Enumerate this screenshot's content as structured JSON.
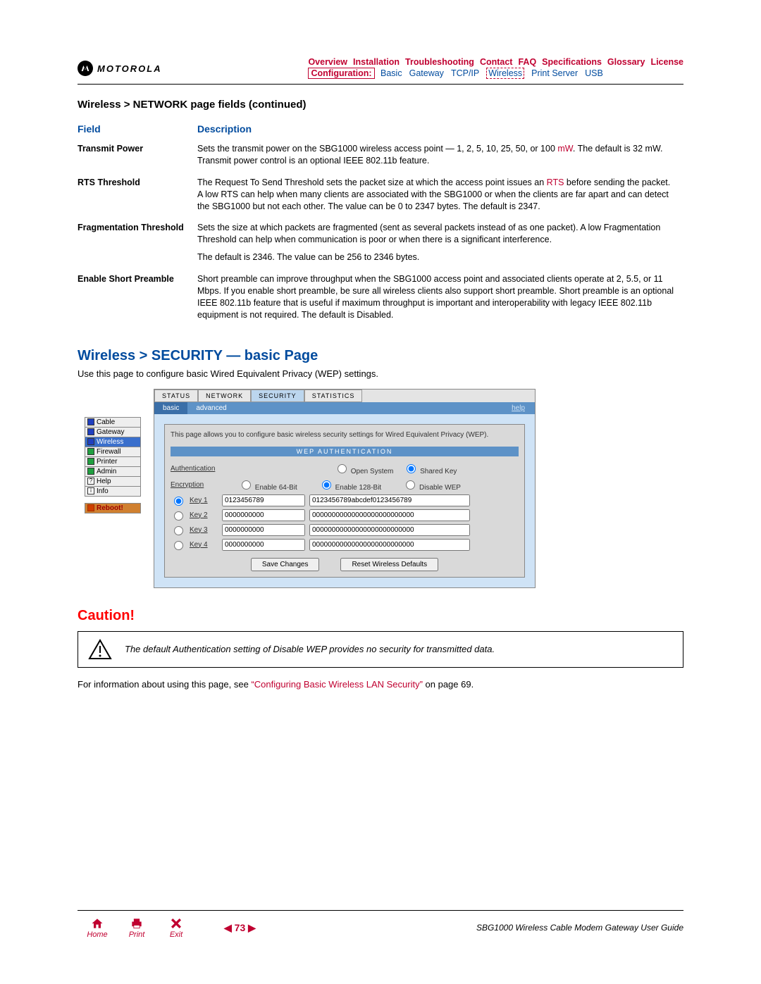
{
  "brand": "MOTOROLA",
  "nav_top": [
    "Overview",
    "Installation",
    "Troubleshooting",
    "Contact",
    "FAQ",
    "Specifications",
    "Glossary",
    "License"
  ],
  "nav_sub": {
    "label": "Configuration:",
    "items": [
      "Basic",
      "Gateway",
      "TCP/IP",
      "Wireless",
      "Print Server",
      "USB"
    ],
    "active": "Wireless"
  },
  "section_title": "Wireless > NETWORK page fields (continued)",
  "th_field": "Field",
  "th_desc": "Description",
  "rows": [
    {
      "name": "Transmit Power",
      "desc_pre": "Sets the transmit power on the SBG1000 wireless access point — 1, 2, 5, 10, 25, 50, or 100 ",
      "gloss": "mW",
      "desc_post": ". The default is 32 mW. Transmit power control is an optional IEEE 802.11b feature."
    },
    {
      "name": "RTS Threshold",
      "desc_pre": "The Request To Send Threshold sets the packet size at which the access point issues an ",
      "gloss": "RTS",
      "desc_post": " before sending the packet. A low RTS can help when many clients are associated with the SBG1000 or when the clients are far apart and can detect the SBG1000 but not each other. The value can be 0 to 2347 bytes. The default is 2347."
    },
    {
      "name": "Fragmentation Threshold",
      "desc_pre": "Sets the size at which packets are fragmented (sent as several packets instead of as one packet). A low Fragmentation Threshold can help when communication is poor or when there is a significant interference.",
      "gloss": "",
      "desc_post": "",
      "desc_para2": "The default is 2346. The value can be 256 to 2346 bytes."
    },
    {
      "name": "Enable Short Preamble",
      "desc_pre": "Short preamble can improve throughput when the SBG1000 access point and associated clients operate at 2, 5.5, or 11 Mbps. If you enable short preamble, be sure all wireless clients also support short preamble. Short preamble is an optional IEEE 802.11b feature that is useful if maximum throughput is important and interoperability with legacy IEEE 802.11b equipment is not required. The default is Disabled.",
      "gloss": "",
      "desc_post": ""
    }
  ],
  "h2_blue": "Wireless > SECURITY — basic Page",
  "intro": "Use this page to configure basic Wired Equivalent Privacy (WEP) settings.",
  "sidenav": [
    {
      "label": "Cable",
      "cls": "blue"
    },
    {
      "label": "Gateway",
      "cls": "blue"
    },
    {
      "label": "Wireless",
      "cls": "blue",
      "active": true
    },
    {
      "label": "Firewall",
      "cls": "grn"
    },
    {
      "label": "Printer",
      "cls": "grn"
    },
    {
      "label": "Admin",
      "cls": "grn"
    },
    {
      "label": "Help",
      "cls": "q",
      "prefix": "?"
    },
    {
      "label": "Info",
      "cls": "q",
      "prefix": "i"
    }
  ],
  "reboot": "Reboot!",
  "tabs1": [
    "STATUS",
    "NETWORK",
    "SECURITY",
    "STATISTICS"
  ],
  "tabs1_active": "SECURITY",
  "tabs2": [
    "basic",
    "advanced"
  ],
  "tabs2_active": "basic",
  "help": "help",
  "panel_note": "This page allows you to configure basic wireless security settings for Wired Equivalent Privacy (WEP).",
  "wep_title": "WEP AUTHENTICATION",
  "auth_label": "Authentication",
  "auth_opts": [
    "Open System",
    "Shared Key"
  ],
  "auth_sel": "Shared Key",
  "enc_label": "Encryption",
  "enc_opts": [
    "Enable 64-Bit",
    "Enable 128-Bit",
    "Disable WEP"
  ],
  "enc_sel": "Enable 128-Bit",
  "keys": [
    {
      "label": "Key 1",
      "sel": true,
      "v64": "0123456789",
      "v128": "0123456789abcdef0123456789"
    },
    {
      "label": "Key 2",
      "sel": false,
      "v64": "0000000000",
      "v128": "00000000000000000000000000"
    },
    {
      "label": "Key 3",
      "sel": false,
      "v64": "0000000000",
      "v128": "00000000000000000000000000"
    },
    {
      "label": "Key 4",
      "sel": false,
      "v64": "0000000000",
      "v128": "00000000000000000000000000"
    }
  ],
  "btn_save": "Save Changes",
  "btn_reset": "Reset Wireless Defaults",
  "h2_red": "Caution!",
  "caution": "The default Authentication setting of Disable WEP provides no security for transmitted data.",
  "after_pre": "For information about using this page, see ",
  "after_link": "“Configuring Basic Wireless LAN Security”",
  "after_post": " on page 69.",
  "foot_home": "Home",
  "foot_print": "Print",
  "foot_exit": "Exit",
  "page_num": "73",
  "guide": "SBG1000 Wireless Cable Modem Gateway User Guide"
}
